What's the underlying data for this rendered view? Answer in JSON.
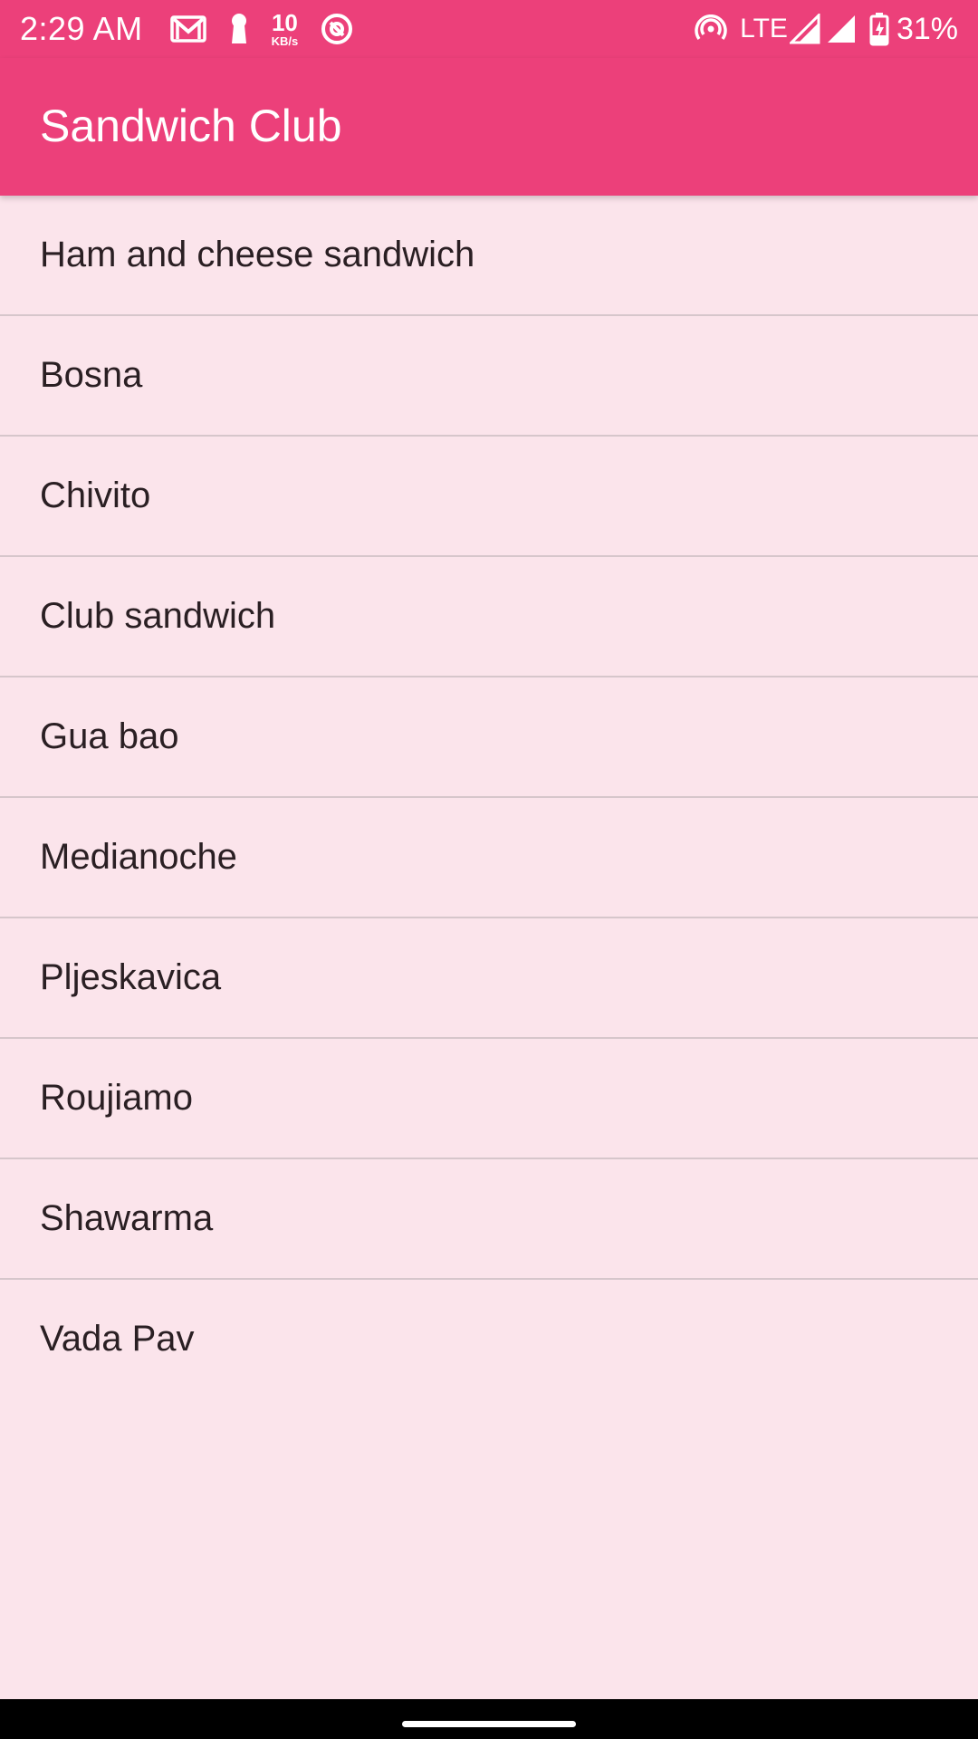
{
  "status_bar": {
    "time": "2:29 AM",
    "speed_value": "10",
    "speed_unit": "KB/s",
    "network": "LTE",
    "battery": "31%",
    "icons_left": [
      "gmail-icon",
      "keyhole-icon",
      "data-speed-icon",
      "circle-at-icon"
    ],
    "icons_right": [
      "hotspot-icon",
      "signal-icon",
      "signal-icon",
      "battery-charging-icon"
    ]
  },
  "app_bar": {
    "title": "Sandwich Club"
  },
  "sandwich_list": {
    "items": [
      "Ham and cheese sandwich",
      "Bosna",
      "Chivito",
      "Club sandwich",
      "Gua bao",
      "Medianoche",
      "Pljeskavica",
      "Roujiamo",
      "Shawarma",
      "Vada Pav"
    ]
  },
  "colors": {
    "primary": "#EC407A",
    "background": "#FBE4EB",
    "divider": "#D6C6CB",
    "text": "#2A1F23"
  }
}
